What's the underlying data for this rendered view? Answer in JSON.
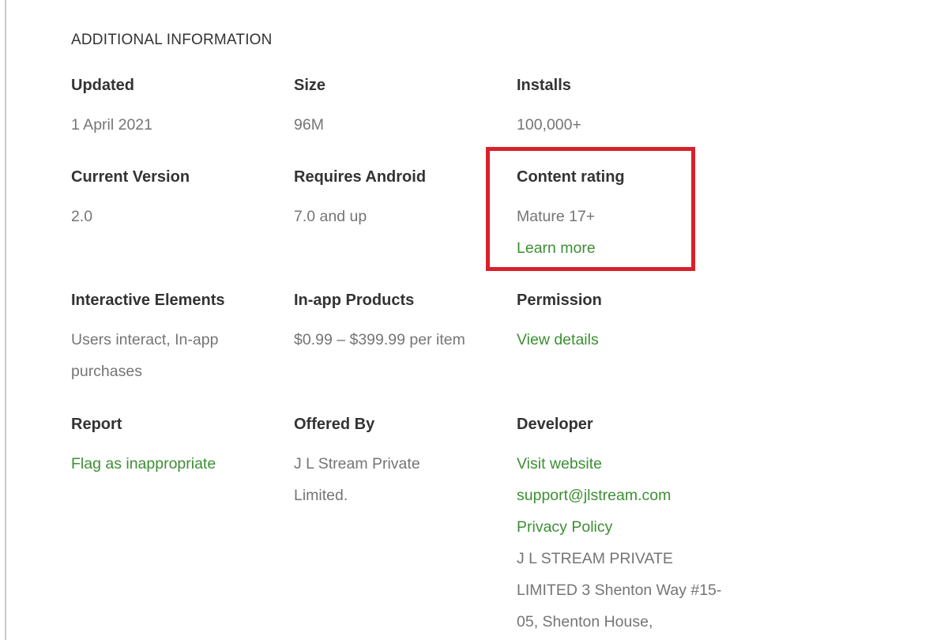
{
  "section": {
    "title": "ADDITIONAL INFORMATION"
  },
  "updated": {
    "label": "Updated",
    "value": "1 April 2021"
  },
  "size": {
    "label": "Size",
    "value": "96M"
  },
  "installs": {
    "label": "Installs",
    "value": "100,000+"
  },
  "current_version": {
    "label": "Current Version",
    "value": "2.0"
  },
  "requires_android": {
    "label": "Requires Android",
    "value": "7.0 and up"
  },
  "content_rating": {
    "label": "Content rating",
    "value": "Mature 17+",
    "learn_more": "Learn more"
  },
  "interactive_elements": {
    "label": "Interactive Elements",
    "value": "Users interact, In-app purchases"
  },
  "in_app_products": {
    "label": "In-app Products",
    "value": "$0.99 – $399.99 per item"
  },
  "permission": {
    "label": "Permission",
    "link": "View details"
  },
  "report": {
    "label": "Report",
    "link": "Flag as inappropriate"
  },
  "offered_by": {
    "label": "Offered By",
    "value": "J L Stream Private Limited."
  },
  "developer": {
    "label": "Developer",
    "website": "Visit website",
    "email": "support@jlstream.com",
    "privacy": "Privacy Policy",
    "address": "J L STREAM PRIVATE LIMITED 3 Shenton Way #15-05, Shenton House,"
  },
  "colors": {
    "link": "#3d8f34",
    "label": "#333333",
    "value": "#757575",
    "highlight": "#d9202b"
  }
}
